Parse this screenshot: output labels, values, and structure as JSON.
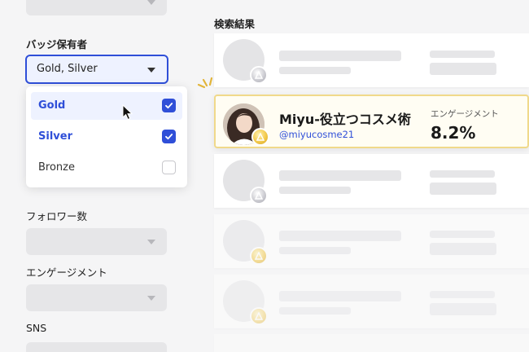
{
  "filters": {
    "badge": {
      "label": "バッジ保有者",
      "selected_value": "Gold, Silver",
      "options": [
        {
          "label": "Gold",
          "checked": true
        },
        {
          "label": "Silver",
          "checked": true
        },
        {
          "label": "Bronze",
          "checked": false
        }
      ]
    },
    "followers": {
      "label": "フォロワー数"
    },
    "engagement": {
      "label": "エンゲージメント"
    },
    "sns": {
      "label": "SNS"
    }
  },
  "results": {
    "title": "検索結果",
    "featured": {
      "name": "Miyu-役立つコスメ術",
      "handle": "@miyucosme21",
      "engagement_label": "エンゲージメント",
      "engagement_value": "8.2%",
      "medal": "gold-medal-icon"
    },
    "placeholder_medals": [
      "silver-medal-icon",
      "silver-medal-icon",
      "gold-medal-icon",
      "gold-medal-icon"
    ]
  },
  "colors": {
    "accent": "#2f4fd8",
    "background": "#f5f5f6",
    "featured_border": "#f0d98a",
    "gold": "#f2c94c",
    "silver": "#c9c9cf"
  }
}
